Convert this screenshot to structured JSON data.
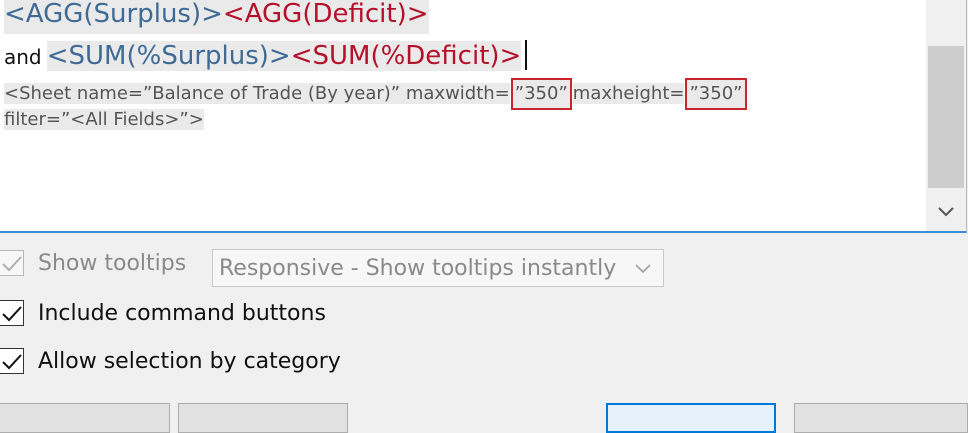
{
  "editor": {
    "line1": [
      {
        "text": "<AGG(Surplus)>",
        "color": "blue"
      },
      {
        "text": "<AGG(Deficit)>",
        "color": "red"
      }
    ],
    "line2": {
      "connector": "and",
      "fields": [
        {
          "text": "<SUM(%Surplus)>",
          "color": "blue"
        },
        {
          "text": "<SUM(%Deficit)>",
          "color": "red"
        }
      ]
    },
    "sheet_tag": {
      "part1": "<Sheet name=”Balance of Trade (By year)” maxwidth=",
      "maxwidth": "”350”",
      "part2": "maxheight=",
      "maxheight": "”350”",
      "line2": "filter=”<All Fields>”>"
    },
    "scroll_down_icon": "chevron-down-icon"
  },
  "options": {
    "show_tooltips": {
      "label": "Show tooltips",
      "checked": true,
      "enabled": false
    },
    "tooltip_mode": {
      "value": "Responsive - Show tooltips instantly",
      "enabled": false
    },
    "include_command_buttons": {
      "label": "Include command buttons",
      "checked": true
    },
    "allow_selection_by_category": {
      "label": "Allow selection by category",
      "checked": true
    }
  },
  "colors": {
    "field_blue": "#3f6b96",
    "field_red": "#b3122a",
    "highlight_box": "#c9242b",
    "focus_border": "#3c8dd8"
  }
}
